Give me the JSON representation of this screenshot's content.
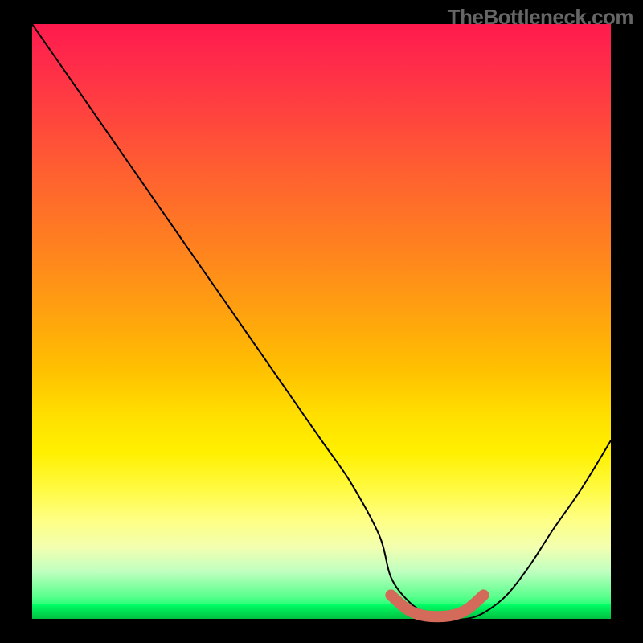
{
  "watermark": "TheBottleneck.com",
  "chart_data": {
    "type": "line",
    "title": "",
    "xlabel": "",
    "ylabel": "",
    "xlim": [
      0,
      100
    ],
    "ylim": [
      0,
      100
    ],
    "series": [
      {
        "name": "bottleneck-curve",
        "x": [
          0,
          5,
          10,
          15,
          20,
          25,
          30,
          35,
          40,
          45,
          50,
          55,
          60,
          62,
          65,
          68,
          72,
          75,
          78,
          82,
          86,
          90,
          95,
          100
        ],
        "y": [
          100,
          93,
          86,
          79,
          72,
          65,
          58,
          51,
          44,
          37,
          30,
          23,
          14,
          7,
          3,
          1,
          0,
          0,
          1,
          4,
          9,
          15,
          22,
          30
        ]
      },
      {
        "name": "optimal-range-marker",
        "x": [
          62,
          65,
          68,
          72,
          75,
          78
        ],
        "y": [
          4,
          1.5,
          0.5,
          0.5,
          1.5,
          4
        ]
      }
    ],
    "gradient_stops": [
      {
        "pct": 0,
        "color": "#ff1a4d"
      },
      {
        "pct": 25,
        "color": "#ff6030"
      },
      {
        "pct": 50,
        "color": "#ffb000"
      },
      {
        "pct": 75,
        "color": "#ffff60"
      },
      {
        "pct": 100,
        "color": "#00e050"
      }
    ]
  }
}
